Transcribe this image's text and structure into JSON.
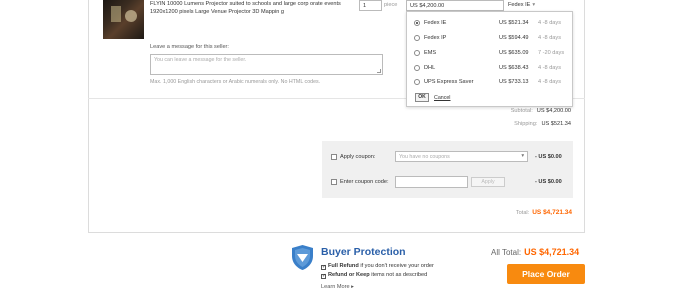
{
  "product": {
    "title": "FLYIN 10000 Lumens Projector suited to schools and large corp orate events 1920x1200 pixels Large Venue Projector 3D Mappin g",
    "quantity": "1",
    "unit": "piece",
    "shipping_cost": "US $4,200.00",
    "shipping_method": "Fedex IE"
  },
  "shipping_options": [
    {
      "name": "Fedex IE",
      "price": "US $521.34",
      "days": "4 -8 days",
      "selected": true
    },
    {
      "name": "Fedex IP",
      "price": "US $594.49",
      "days": "4 -8 days",
      "selected": false
    },
    {
      "name": "EMS",
      "price": "US $635.09",
      "days": "7 -20 days",
      "selected": false
    },
    {
      "name": "DHL",
      "price": "US $638.43",
      "days": "4 -8 days",
      "selected": false
    },
    {
      "name": "UPS Express Saver",
      "price": "US $733.13",
      "days": "4 -8 days",
      "selected": false
    }
  ],
  "shipping_dropdown": {
    "ok_label": "OK",
    "cancel_label": "Cancel"
  },
  "message": {
    "label": "Leave a message for this seller:",
    "placeholder": "You can leave a message for the seller.",
    "hint": "Max. 1,000 English characters or Arabic numerals only. No HTML codes."
  },
  "summary": {
    "subtotal_label": "Subtotal:",
    "subtotal": "US $4,200.00",
    "shipping_label": "Shipping:",
    "shipping": "US $521.34",
    "total_label": "Total:",
    "total": "US $4,721.34"
  },
  "coupon": {
    "apply_label": "Apply coupon:",
    "select_placeholder": "You have no coupons",
    "apply_discount": "- US $0.00",
    "code_label": "Enter coupon code:",
    "apply_button": "Apply",
    "code_discount": "- US $0.00"
  },
  "buyer_protection": {
    "title": "Buyer Protection",
    "line1_bold": "Full Refund",
    "line1_rest": "if you don't receive your order",
    "line2_bold": "Refund or Keep",
    "line2_rest": "items not as described",
    "learn_more": "Learn More"
  },
  "checkout": {
    "all_total_label": "All Total:",
    "all_total": "US $4,721.34",
    "place_order": "Place Order"
  },
  "colors": {
    "accent": "#f88a0f",
    "total": "#ff6600",
    "protection_blue": "#2a5fa8"
  },
  "icons": [
    "shield-icon",
    "checkbox-icon",
    "chevron-down-icon",
    "arrow-right-icon"
  ]
}
